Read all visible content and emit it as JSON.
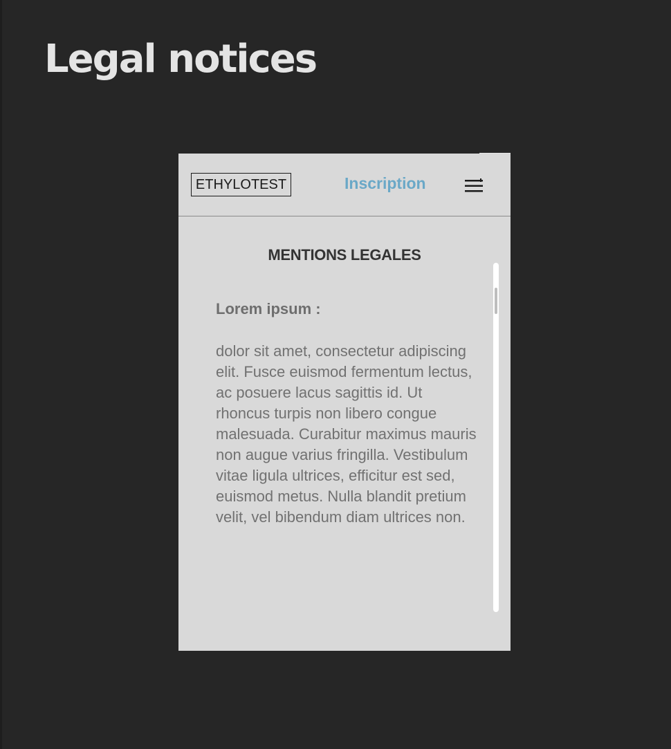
{
  "page": {
    "title": "Legal notices"
  },
  "header": {
    "logo_text": "ETHYLOTEST",
    "signup_link": "Inscription",
    "menu_icon": "hamburger-menu-icon"
  },
  "content": {
    "section_title": "MENTIONS LEGALES",
    "subheading": "Lorem ipsum :",
    "body": "dolor sit amet, consectetur adipiscing elit. Fusce euismod fermentum lectus, ac posuere lacus sagittis id. Ut rhoncus turpis non libero congue malesuada. Curabitur maximus mauris non augue varius fringilla. Vestibulum vitae ligula ultrices, efficitur est sed, euismod metus. Nulla blandit pretium velit, vel bibendum diam ultrices non."
  },
  "colors": {
    "background": "#262626",
    "phone_background": "#d9d9d9",
    "accent": "#6aa8c7",
    "title_text": "#e4e4e4",
    "body_text": "#717171"
  }
}
